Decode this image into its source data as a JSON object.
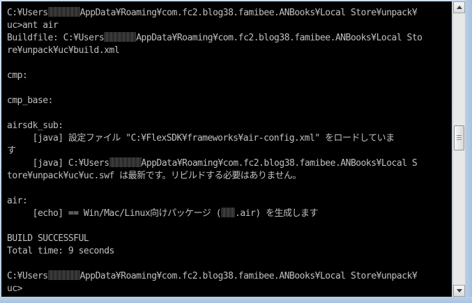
{
  "console": {
    "lines": [
      {
        "pre": "C:¥Users",
        "redact": true,
        "post": "AppData¥Roaming¥com.fc2.blog38.famibee.ANBooks¥Local Store¥unpack¥"
      },
      {
        "text": "uc>ant air"
      },
      {
        "pre": "Buildfile: C:¥Users",
        "redact": true,
        "post": "AppData¥Roaming¥com.fc2.blog38.famibee.ANBooks¥Local Sto"
      },
      {
        "text": "re¥unpack¥uc¥build.xml"
      },
      {
        "text": ""
      },
      {
        "text": "cmp:"
      },
      {
        "text": ""
      },
      {
        "text": "cmp_base:"
      },
      {
        "text": ""
      },
      {
        "text": "airsdk_sub:"
      },
      {
        "text": "     [java] 設定ファイル \"C:¥FlexSDK¥frameworks¥air-config.xml\" をロードしていま"
      },
      {
        "text": "す"
      },
      {
        "pre": "     [java] C:¥Users",
        "redact": true,
        "post": "AppData¥Roaming¥com.fc2.blog38.famibee.ANBooks¥Local S"
      },
      {
        "text": "tore¥unpack¥uc¥uc.swf は最新です。リビルドする必要はありません。"
      },
      {
        "text": ""
      },
      {
        "text": "air:"
      },
      {
        "pre": "     [echo] == Win/Mac/Linux向けパッケージ (",
        "redact_small": true,
        "post": ".air) を生成します"
      },
      {
        "text": ""
      },
      {
        "text": "BUILD SUCCESSFUL"
      },
      {
        "text": "Total time: 9 seconds"
      },
      {
        "text": ""
      },
      {
        "pre": "C:¥Users",
        "redact": true,
        "post": "AppData¥Roaming¥com.fc2.blog38.famibee.ANBooks¥Local Store¥unpack¥"
      },
      {
        "text": "uc>"
      }
    ]
  },
  "scrollbar": {
    "position_fraction": 0.42,
    "up_icon": "arrow-up-icon",
    "down_icon": "arrow-down-icon"
  }
}
